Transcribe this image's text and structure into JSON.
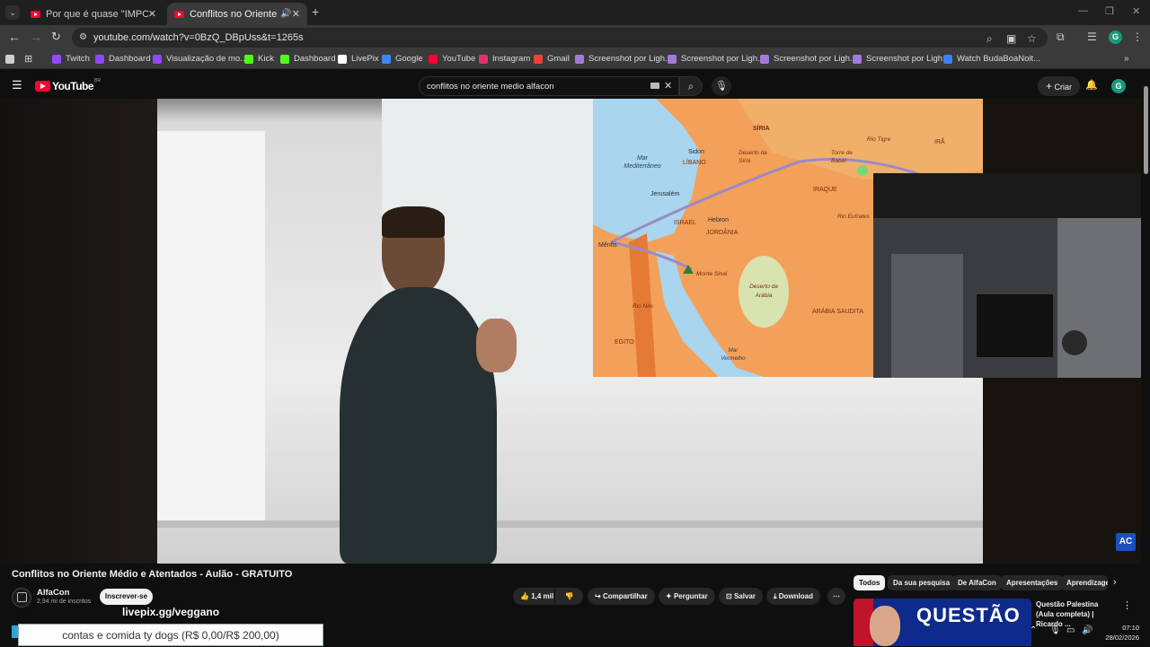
{
  "browser": {
    "tabs": [
      {
        "title": "Por que é quase \"IMPOSSÍVEL\"",
        "active": false
      },
      {
        "title": "Conflitos no Oriente Médio",
        "active": true
      }
    ],
    "url": "youtube.com/watch?v=0BzQ_DBpUss&t=1265s",
    "bookmarks": [
      {
        "label": "Twitch",
        "icon": "twitch-icon",
        "color": "#9146ff"
      },
      {
        "label": "Dashboard",
        "icon": "twitch-icon",
        "color": "#9146ff"
      },
      {
        "label": "Visualização de mo...",
        "icon": "twitch-icon",
        "color": "#9146ff"
      },
      {
        "label": "Kick",
        "icon": "kick-icon",
        "color": "#53fc18"
      },
      {
        "label": "Dashboard",
        "icon": "kick-icon",
        "color": "#53fc18"
      },
      {
        "label": "LivePix",
        "icon": "livepix-icon",
        "color": "#ffffff"
      },
      {
        "label": "Google",
        "icon": "google-icon",
        "color": "#4285f4"
      },
      {
        "label": "YouTube",
        "icon": "youtube-icon",
        "color": "#ff0033"
      },
      {
        "label": "Instagram",
        "icon": "instagram-icon",
        "color": "#e1306c"
      },
      {
        "label": "Gmail",
        "icon": "gmail-icon",
        "color": "#ea4335"
      },
      {
        "label": "Screenshot por Ligh...",
        "icon": "lightshot-icon",
        "color": "#a27bd8"
      },
      {
        "label": "Screenshot por Ligh...",
        "icon": "lightshot-icon",
        "color": "#a27bd8"
      },
      {
        "label": "Screenshot por Ligh...",
        "icon": "lightshot-icon",
        "color": "#a27bd8"
      },
      {
        "label": "Screenshot por Ligh...",
        "icon": "lightshot-icon",
        "color": "#a27bd8"
      },
      {
        "label": "Watch BudaBoaNoit...",
        "icon": "globe-icon",
        "color": "#3b82f6"
      }
    ]
  },
  "youtube": {
    "logo_text": "YouTube",
    "logo_region": "BR",
    "search_value": "conflitos no oriente medio alfacon",
    "create_label": "Criar",
    "profile_initial": "G"
  },
  "map_labels": {
    "siria": "SÍRIA",
    "mar_mediterraneo": "Mar Mediterrâneo",
    "sidon": "Sidon",
    "libano": "LÍBANO",
    "deserto_siria": "Deserto da Síria",
    "torre_babel": "Torre de Babel",
    "rio_tigre": "Rio Tigre",
    "ira": "IRÃ",
    "iraque": "IRAQUE",
    "jerusalem": "Jerusalém",
    "israel": "ISRAEL",
    "hebron": "Hebron",
    "jordania": "JORDÂNIA",
    "rio_eufrates": "Rio Eufrates",
    "menfis": "Mênfis",
    "monte_sinai": "Monte Sinai",
    "deserto_arabia": "Deserto da Arábia",
    "rio_nilo": "Rio Nilo",
    "arabia": "ARÁBIA SAUDITA",
    "egito": "EGITO",
    "mar_vermelho": "Mar Vermelho"
  },
  "video": {
    "title": "Conflitos no Oriente Médio e Atentados - Aulão - GRATUITO",
    "channel": "AlfaCon",
    "subscribers": "2,94 mi de inscritos",
    "subscribe_label": "Inscrever-se",
    "likes": "1,4 mil",
    "share_label": "Compartilhar",
    "ask_label": "Perguntar",
    "save_label": "Salvar",
    "download_label": "Download",
    "watermark": "AC"
  },
  "chips": [
    "Todos",
    "Da sua pesquisa",
    "De AlfaCon",
    "Apresentações",
    "Aprendizagem"
  ],
  "recommendation": {
    "thumb_text": "QUESTÃO",
    "title": "Questão Palestina (Aula completa) | Ricardo ..."
  },
  "overlay": {
    "livepix_text": "livepix.gg/veggano",
    "donation_text": "contas e comida ty dogs (R$ 0,00/R$ 200,00)",
    "donation_progress": 0
  },
  "taskbar": {
    "time": "07:10",
    "date": "28/02/2026"
  }
}
